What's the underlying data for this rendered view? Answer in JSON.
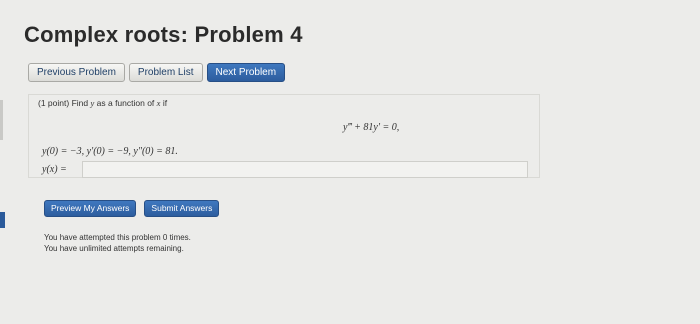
{
  "page": {
    "title": "Complex roots: Problem 4"
  },
  "nav": {
    "previous_label": "Previous Problem",
    "list_label": "Problem List",
    "next_label": "Next Problem"
  },
  "problem": {
    "points": "(1 point)",
    "prompt_a": "Find",
    "var_y": "y",
    "prompt_b": "as a function of",
    "var_x": "x",
    "prompt_c": "if",
    "equation": "y‴ + 81y′ = 0,",
    "initial_conditions": "y(0) = −3,  y′(0) = −9,  y″(0) = 81.",
    "answer_label": "y(x) =",
    "answer_value": ""
  },
  "actions": {
    "preview_label": "Preview My Answers",
    "submit_label": "Submit Answers"
  },
  "status": {
    "attempts_line": "You have attempted this problem 0 times.",
    "remaining_line": "You have unlimited attempts remaining."
  },
  "colors": {
    "primary_button": "#2d5d9e",
    "background": "#ececea"
  }
}
